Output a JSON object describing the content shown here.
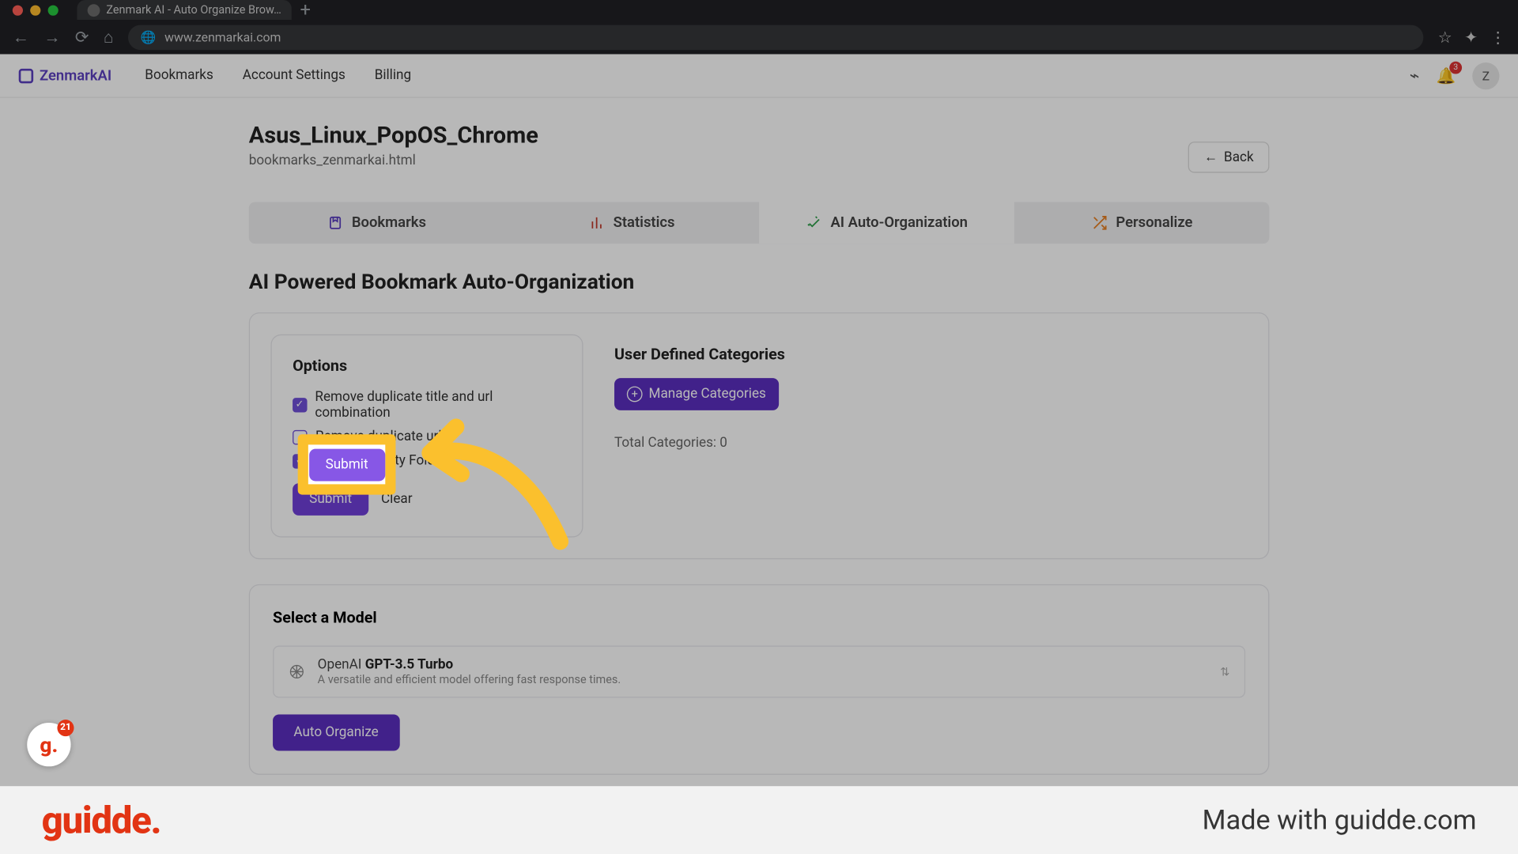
{
  "browser": {
    "tab_title": "Zenmark AI - Auto Organize Brow…",
    "url": "www.zenmarkai.com"
  },
  "header": {
    "brand": "ZenmarkAI",
    "nav": [
      "Bookmarks",
      "Account Settings",
      "Billing"
    ],
    "notification_count": "3",
    "avatar_initial": "Z"
  },
  "page": {
    "title": "Asus_Linux_PopOS_Chrome",
    "subtitle": "bookmarks_zenmarkai.html",
    "back_label": "Back"
  },
  "tabs": {
    "bookmarks": "Bookmarks",
    "statistics": "Statistics",
    "ai_auto": "AI Auto-Organization",
    "personalize": "Personalize"
  },
  "section_title": "AI Powered Bookmark Auto-Organization",
  "options": {
    "heading": "Options",
    "items": [
      {
        "label": "Remove duplicate title and url combination",
        "checked": true
      },
      {
        "label": "Remove duplicate urls",
        "checked": false
      },
      {
        "label": "Remove Empty Folders",
        "checked": true
      }
    ],
    "submit": "Submit",
    "clear": "Clear"
  },
  "categories": {
    "heading": "User Defined Categories",
    "manage_label": "Manage Categories",
    "total_label": "Total Categories: 0"
  },
  "model": {
    "heading": "Select a Model",
    "provider": "OpenAI ",
    "name": "GPT-3.5 Turbo",
    "description": "A versatile and efficient model offering fast response times.",
    "auto_organize": "Auto Organize"
  },
  "highlight": {
    "submit": "Submit"
  },
  "guidde": {
    "logo_text": "guidde.",
    "made_with": "Made with guidde.com",
    "badge_count": "21"
  }
}
